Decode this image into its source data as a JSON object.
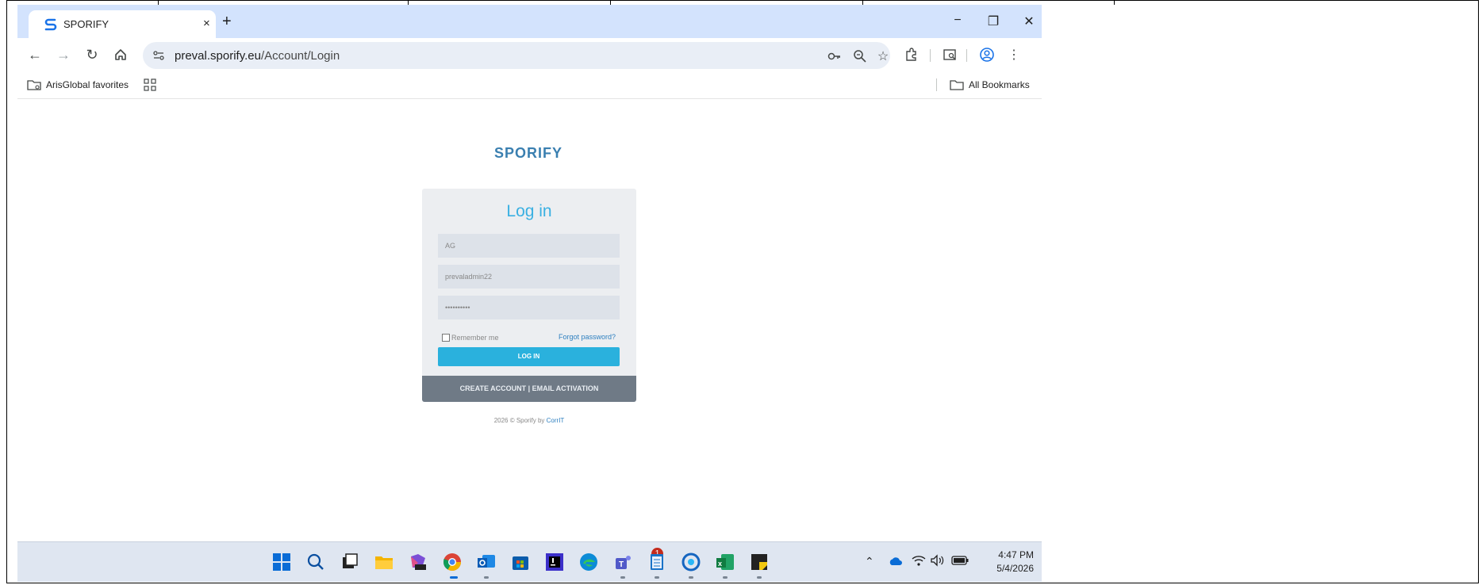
{
  "browser": {
    "tab_title": "SPORIFY",
    "tab_close": "×",
    "new_tab": "+",
    "window_controls": {
      "minimize": "−",
      "restore": "❐",
      "close": "✕"
    },
    "url_host": "preval.sporify.eu",
    "url_path": "/Account/Login"
  },
  "bookmarks": {
    "folder_label": "ArisGlobal favorites",
    "all_bookmarks_label": "All Bookmarks"
  },
  "login": {
    "logo_text": "SPORIFY",
    "title": "Log in",
    "tenant_value": "AG",
    "username_value": "prevaladmin22",
    "password_value": "••••••••••",
    "remember_label": "Remember me",
    "forgot_label": "Forgot password?",
    "login_button": "LOG IN",
    "create_account": "CREATE ACCOUNT | EMAIL ACTIVATION",
    "footer_prefix": "2026 © Sporify by",
    "footer_link": "CorrIT"
  },
  "taskbar": {
    "time": "4:47 PM",
    "date": "5/4/2026",
    "teams_badge": "1"
  },
  "colors": {
    "accent": "#3ab0e2",
    "login_button": "#2ab1dd",
    "create_bar": "#6f7a86",
    "tabstrip": "#d3e3fd"
  }
}
